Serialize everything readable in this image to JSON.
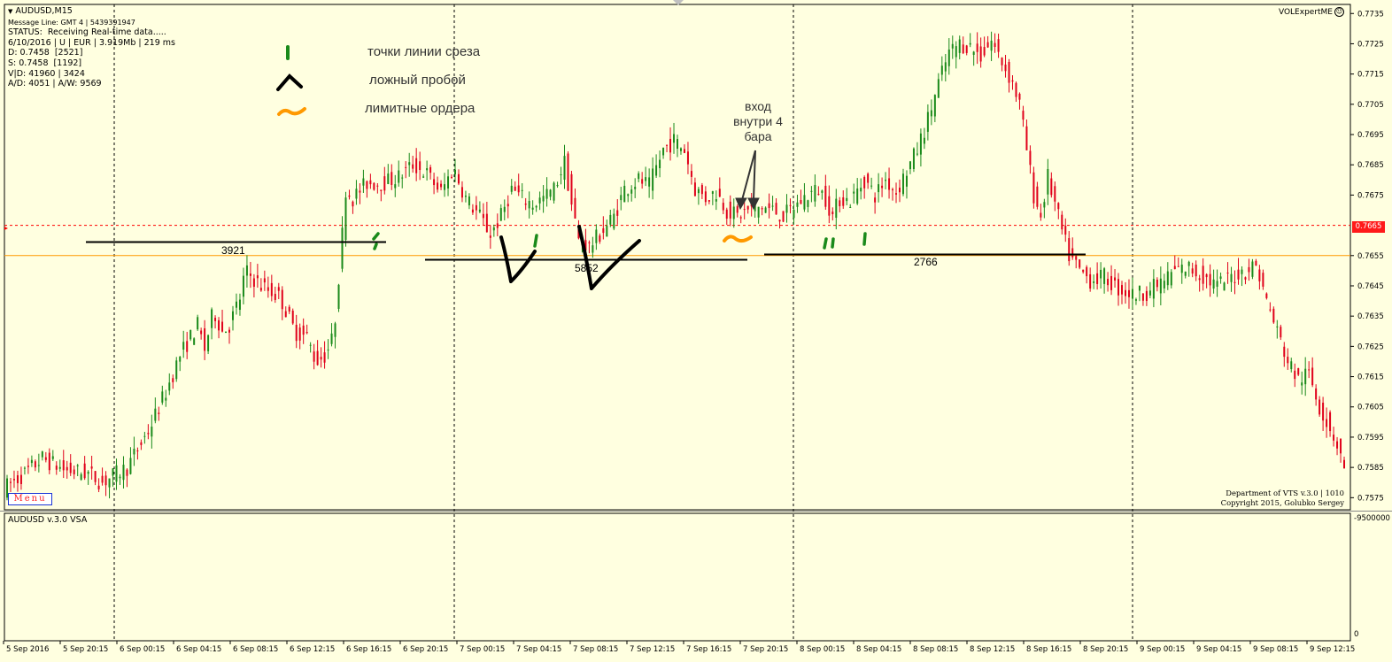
{
  "symbol_title": "AUDUSD,M15",
  "info_lines": [
    "Message Line: GMT 4 | 5439391947",
    "STATUS:  Receiving Real-time data.....",
    "6/10/2016 | U | EUR | 3.919Mb | 219 ms",
    "D: 0.7458  [2521]",
    "S: 0.7458  [1192]",
    "V|D: 41960 | 3424",
    "A/D: 4051 | A/W: 9569"
  ],
  "expert_name": "VOLExpertME",
  "expert_icon": "smiley-icon",
  "menu_label": "Menu",
  "legend": [
    {
      "text": "точки линии среза",
      "mark": "green-tick-icon",
      "color": "#1a8a1a"
    },
    {
      "text": "ложный пробой",
      "mark": "caret-icon",
      "color": "#000000"
    },
    {
      "text": "лимитные ордера",
      "mark": "tilde-icon",
      "color": "#ff9900"
    }
  ],
  "annotation": {
    "lines": [
      "вход",
      "внутри 4",
      "бара"
    ]
  },
  "level_labels": [
    "3921",
    "5852",
    "2766"
  ],
  "copyright_lines": [
    "Department of VTS  v.3.0 | 1010",
    "Copyright 2015, Golubko Sergey"
  ],
  "subwindow_title": "AUDUSD v.3.0 VSA",
  "sub_axis_labels": [
    "-9500000",
    "0"
  ],
  "current_price": "0.7665",
  "colors": {
    "background": "#ffffe0",
    "bull": "#1a8a1a",
    "bear": "#e0001a",
    "orange_level": "#ff9900",
    "red_dash": "#ff0000"
  },
  "chart_data": {
    "type": "candlestick",
    "price_axis": [
      "0.7735",
      "0.7725",
      "0.7715",
      "0.7705",
      "0.7695",
      "0.7685",
      "0.7675",
      "0.7655",
      "0.7645",
      "0.7635",
      "0.7625",
      "0.7615",
      "0.7605",
      "0.7595",
      "0.7585",
      "0.7575"
    ],
    "ylim": [
      0.7571,
      0.7738
    ],
    "time_axis": [
      "5 Sep 2016",
      "5 Sep 20:15",
      "6 Sep 00:15",
      "6 Sep 04:15",
      "6 Sep 08:15",
      "6 Sep 12:15",
      "6 Sep 16:15",
      "6 Sep 20:15",
      "7 Sep 00:15",
      "7 Sep 04:15",
      "7 Sep 08:15",
      "7 Sep 12:15",
      "7 Sep 16:15",
      "7 Sep 20:15",
      "8 Sep 00:15",
      "8 Sep 04:15",
      "8 Sep 08:15",
      "8 Sep 12:15",
      "8 Sep 16:15",
      "8 Sep 20:15",
      "9 Sep 00:15",
      "9 Sep 04:15",
      "9 Sep 08:15",
      "9 Sep 12:15"
    ],
    "horizontal_levels": [
      {
        "price": 0.7665,
        "style": "dashed",
        "color": "#ff0000"
      },
      {
        "price": 0.7655,
        "style": "solid",
        "color": "#ff9900"
      }
    ],
    "path": [
      [
        0,
        0.7578
      ],
      [
        12,
        0.7583
      ],
      [
        22,
        0.7588
      ],
      [
        35,
        0.7584
      ],
      [
        48,
        0.7583
      ],
      [
        56,
        0.758
      ],
      [
        70,
        0.7585
      ],
      [
        82,
        0.7597
      ],
      [
        92,
        0.761
      ],
      [
        100,
        0.7622
      ],
      [
        110,
        0.7632
      ],
      [
        114,
        0.7624
      ],
      [
        119,
        0.7637
      ],
      [
        124,
        0.763
      ],
      [
        128,
        0.7632
      ],
      [
        134,
        0.7641
      ],
      [
        137,
        0.765
      ],
      [
        146,
        0.7645
      ],
      [
        152,
        0.7643
      ],
      [
        157,
        0.7641
      ],
      [
        165,
        0.763
      ],
      [
        172,
        0.7628
      ],
      [
        177,
        0.762
      ],
      [
        182,
        0.7622
      ],
      [
        187,
        0.7628
      ],
      [
        190,
        0.7648
      ],
      [
        192,
        0.7662
      ],
      [
        194,
        0.7677
      ],
      [
        198,
        0.7674
      ],
      [
        206,
        0.7679
      ],
      [
        215,
        0.7679
      ],
      [
        224,
        0.7681
      ],
      [
        232,
        0.7685
      ],
      [
        240,
        0.7682
      ],
      [
        248,
        0.7676
      ],
      [
        255,
        0.7684
      ],
      [
        262,
        0.7674
      ],
      [
        270,
        0.7668
      ],
      [
        276,
        0.7662
      ],
      [
        282,
        0.7668
      ],
      [
        288,
        0.7677
      ],
      [
        294,
        0.7674
      ],
      [
        300,
        0.7672
      ],
      [
        306,
        0.7674
      ],
      [
        312,
        0.7677
      ],
      [
        318,
        0.7686
      ],
      [
        322,
        0.7672
      ],
      [
        326,
        0.766
      ],
      [
        332,
        0.7658
      ],
      [
        338,
        0.7662
      ],
      [
        346,
        0.7668
      ],
      [
        352,
        0.7677
      ],
      [
        360,
        0.768
      ],
      [
        366,
        0.7678
      ],
      [
        374,
        0.769
      ],
      [
        380,
        0.7693
      ],
      [
        386,
        0.769
      ],
      [
        392,
        0.7677
      ],
      [
        398,
        0.7674
      ],
      [
        404,
        0.7676
      ],
      [
        410,
        0.767
      ],
      [
        416,
        0.7668
      ],
      [
        422,
        0.767
      ],
      [
        430,
        0.7671
      ],
      [
        436,
        0.767
      ],
      [
        442,
        0.7668
      ],
      [
        450,
        0.7672
      ],
      [
        456,
        0.7675
      ],
      [
        462,
        0.7677
      ],
      [
        466,
        0.7674
      ],
      [
        470,
        0.7668
      ],
      [
        474,
        0.7674
      ],
      [
        480,
        0.7673
      ],
      [
        488,
        0.768
      ],
      [
        494,
        0.7675
      ],
      [
        500,
        0.768
      ],
      [
        506,
        0.7676
      ],
      [
        512,
        0.7683
      ],
      [
        518,
        0.769
      ],
      [
        524,
        0.77
      ],
      [
        530,
        0.7712
      ],
      [
        536,
        0.7722
      ],
      [
        542,
        0.7725
      ],
      [
        548,
        0.7724
      ],
      [
        554,
        0.7721
      ],
      [
        560,
        0.7726
      ],
      [
        566,
        0.7719
      ],
      [
        572,
        0.7712
      ],
      [
        576,
        0.7705
      ],
      [
        580,
        0.769
      ],
      [
        584,
        0.7675
      ],
      [
        588,
        0.7668
      ],
      [
        592,
        0.7681
      ],
      [
        596,
        0.7672
      ],
      [
        600,
        0.7663
      ],
      [
        604,
        0.7655
      ],
      [
        610,
        0.765
      ],
      [
        616,
        0.7647
      ],
      [
        624,
        0.7648
      ],
      [
        632,
        0.7644
      ],
      [
        640,
        0.7642
      ],
      [
        648,
        0.7643
      ],
      [
        656,
        0.7646
      ],
      [
        664,
        0.765
      ],
      [
        672,
        0.7651
      ],
      [
        680,
        0.7648
      ],
      [
        688,
        0.7645
      ],
      [
        696,
        0.7648
      ],
      [
        704,
        0.765
      ],
      [
        710,
        0.7652
      ],
      [
        716,
        0.764
      ],
      [
        722,
        0.763
      ],
      [
        728,
        0.762
      ],
      [
        734,
        0.7614
      ],
      [
        740,
        0.7616
      ],
      [
        746,
        0.7605
      ],
      [
        752,
        0.7598
      ],
      [
        758,
        0.759
      ],
      [
        760,
        0.7584
      ]
    ]
  }
}
